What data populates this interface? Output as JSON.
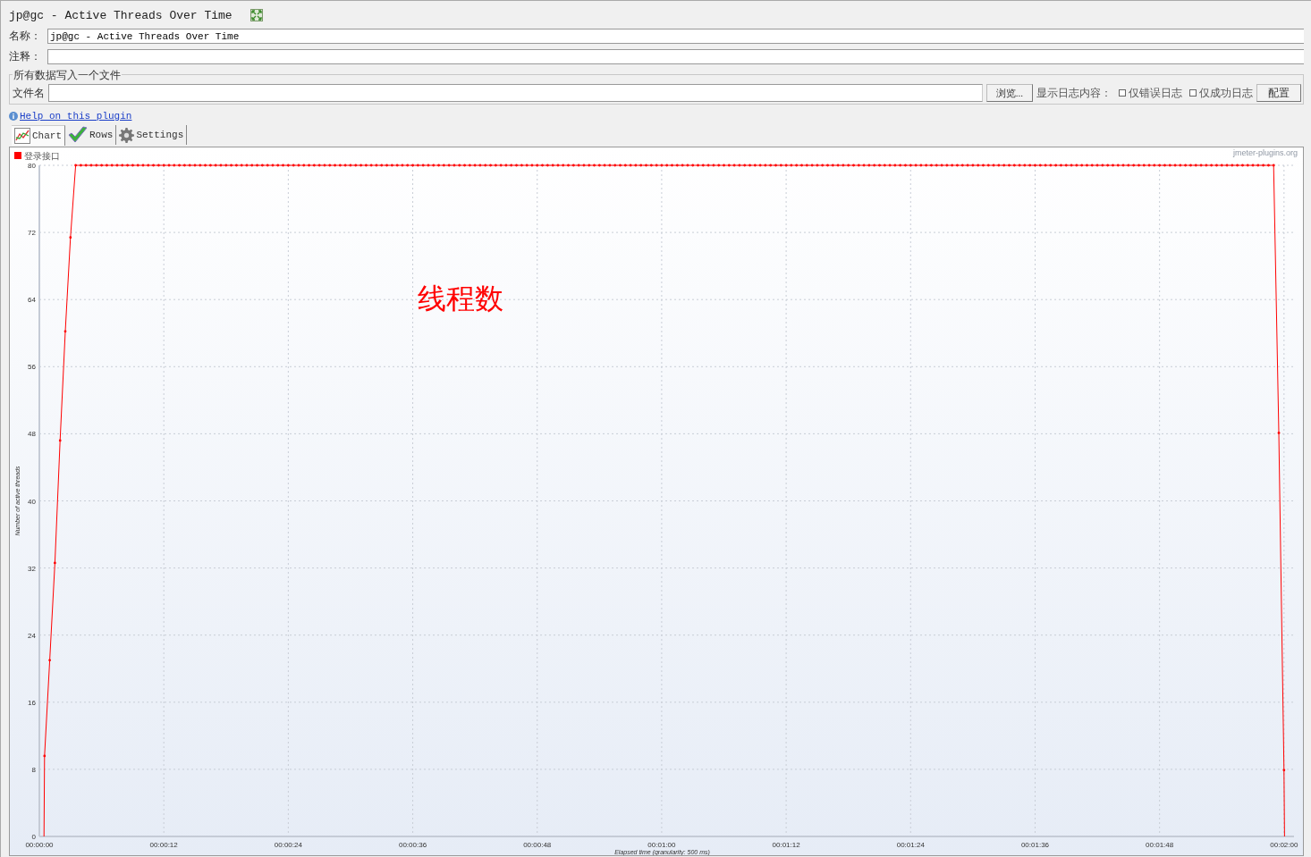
{
  "header": {
    "title": "jp@gc - Active Threads Over Time"
  },
  "name_field": {
    "label": "名称：",
    "value": "jp@gc - Active Threads Over Time"
  },
  "comment_field": {
    "label": "注释："
  },
  "file_group": {
    "title": "所有数据写入一个文件",
    "file_label": "文件名",
    "browse_button": "浏览...",
    "log_label": "显示日志内容：",
    "config_button": "配置",
    "checkboxes": [
      {
        "label": "仅错误日志",
        "checked": false
      },
      {
        "label": "仅成功日志",
        "checked": false
      }
    ]
  },
  "help_link": "Help on this plugin",
  "tabs": [
    {
      "label": "Chart",
      "kind": "chart",
      "selected": true
    },
    {
      "label": "Rows",
      "kind": "rows",
      "selected": false
    },
    {
      "label": "Settings",
      "kind": "settings",
      "selected": false
    }
  ],
  "chart": {
    "credit": "jmeter-plugins.org",
    "chart_data": {
      "type": "line",
      "xlabel": "Elapsed time (granularity: 500 ms)",
      "ylabel": "Number of active threads",
      "xlim": [
        0,
        120.1
      ],
      "ylim": [
        0,
        80
      ],
      "yticks": [
        0,
        8,
        16,
        24,
        32,
        40,
        48,
        56,
        64,
        72,
        80
      ],
      "xticks": [
        {
          "value": 0,
          "label": "00:00:00"
        },
        {
          "value": 12,
          "label": "00:00:12"
        },
        {
          "value": 24,
          "label": "00:00:24"
        },
        {
          "value": 36,
          "label": "00:00:36"
        },
        {
          "value": 48,
          "label": "00:00:48"
        },
        {
          "value": 60,
          "label": "00:01:00"
        },
        {
          "value": 72,
          "label": "00:01:12"
        },
        {
          "value": 84,
          "label": "00:01:24"
        },
        {
          "value": 96,
          "label": "00:01:36"
        },
        {
          "value": 108,
          "label": "00:01:48"
        },
        {
          "value": 120,
          "label": "00:02:00"
        }
      ],
      "annotations": [
        "线程数"
      ],
      "grid": true,
      "x": [
        0.45,
        0.5,
        1,
        1.5,
        2,
        2.5,
        3,
        3.5,
        4,
        4.5,
        5,
        5.5,
        6,
        6.5,
        7,
        7.5,
        8,
        8.5,
        9,
        9.5,
        10,
        10.5,
        11,
        11.5,
        12,
        12.5,
        13,
        13.5,
        14,
        14.5,
        15,
        15.5,
        16,
        16.5,
        17,
        17.5,
        18,
        18.5,
        19,
        19.5,
        20,
        20.5,
        21,
        21.5,
        22,
        22.5,
        23,
        23.5,
        24,
        24.5,
        25,
        25.5,
        26,
        26.5,
        27,
        27.5,
        28,
        28.5,
        29,
        29.5,
        30,
        30.5,
        31,
        31.5,
        32,
        32.5,
        33,
        33.5,
        34,
        34.5,
        35,
        35.5,
        36,
        36.5,
        37,
        37.5,
        38,
        38.5,
        39,
        39.5,
        40,
        40.5,
        41,
        41.5,
        42,
        42.5,
        43,
        43.5,
        44,
        44.5,
        45,
        45.5,
        46,
        46.5,
        47,
        47.5,
        48,
        48.5,
        49,
        49.5,
        50,
        50.5,
        51,
        51.5,
        52,
        52.5,
        53,
        53.5,
        54,
        54.5,
        55,
        55.5,
        56,
        56.5,
        57,
        57.5,
        58,
        58.5,
        59,
        59.5,
        60,
        60.5,
        61,
        61.5,
        62,
        62.5,
        63,
        63.5,
        64,
        64.5,
        65,
        65.5,
        66,
        66.5,
        67,
        67.5,
        68,
        68.5,
        69,
        69.5,
        70,
        70.5,
        71,
        71.5,
        72,
        72.5,
        73,
        73.5,
        74,
        74.5,
        75,
        75.5,
        76,
        76.5,
        77,
        77.5,
        78,
        78.5,
        79,
        79.5,
        80,
        80.5,
        81,
        81.5,
        82,
        82.5,
        83,
        83.5,
        84,
        84.5,
        85,
        85.5,
        86,
        86.5,
        87,
        87.5,
        88,
        88.5,
        89,
        89.5,
        90,
        90.5,
        91,
        91.5,
        92,
        92.5,
        93,
        93.5,
        94,
        94.5,
        95,
        95.5,
        96,
        96.5,
        97,
        97.5,
        98,
        98.5,
        99,
        99.5,
        100,
        100.5,
        101,
        101.5,
        102,
        102.5,
        103,
        103.5,
        104,
        104.5,
        105,
        105.5,
        106,
        106.5,
        107,
        107.5,
        108,
        108.5,
        109,
        109.5,
        110,
        110.5,
        111,
        111.5,
        112,
        112.5,
        113,
        113.5,
        114,
        114.5,
        115,
        115.5,
        116,
        116.5,
        117,
        117.5,
        118,
        118.5,
        119,
        119.5,
        120,
        120.05
      ],
      "series": [
        {
          "name": "登录接口",
          "color": "#ff0000",
          "values": [
            0,
            9.6,
            21,
            32.6,
            47.2,
            60.2,
            71.4,
            80,
            80,
            80,
            80,
            80,
            80,
            80,
            80,
            80,
            80,
            80,
            80,
            80,
            80,
            80,
            80,
            80,
            80,
            80,
            80,
            80,
            80,
            80,
            80,
            80,
            80,
            80,
            80,
            80,
            80,
            80,
            80,
            80,
            80,
            80,
            80,
            80,
            80,
            80,
            80,
            80,
            80,
            80,
            80,
            80,
            80,
            80,
            80,
            80,
            80,
            80,
            80,
            80,
            80,
            80,
            80,
            80,
            80,
            80,
            80,
            80,
            80,
            80,
            80,
            80,
            80,
            80,
            80,
            80,
            80,
            80,
            80,
            80,
            80,
            80,
            80,
            80,
            80,
            80,
            80,
            80,
            80,
            80,
            80,
            80,
            80,
            80,
            80,
            80,
            80,
            80,
            80,
            80,
            80,
            80,
            80,
            80,
            80,
            80,
            80,
            80,
            80,
            80,
            80,
            80,
            80,
            80,
            80,
            80,
            80,
            80,
            80,
            80,
            80,
            80,
            80,
            80,
            80,
            80,
            80,
            80,
            80,
            80,
            80,
            80,
            80,
            80,
            80,
            80,
            80,
            80,
            80,
            80,
            80,
            80,
            80,
            80,
            80,
            80,
            80,
            80,
            80,
            80,
            80,
            80,
            80,
            80,
            80,
            80,
            80,
            80,
            80,
            80,
            80,
            80,
            80,
            80,
            80,
            80,
            80,
            80,
            80,
            80,
            80,
            80,
            80,
            80,
            80,
            80,
            80,
            80,
            80,
            80,
            80,
            80,
            80,
            80,
            80,
            80,
            80,
            80,
            80,
            80,
            80,
            80,
            80,
            80,
            80,
            80,
            80,
            80,
            80,
            80,
            80,
            80,
            80,
            80,
            80,
            80,
            80,
            80,
            80,
            80,
            80,
            80,
            80,
            80,
            80,
            80,
            80,
            80,
            80,
            80,
            80,
            80,
            80,
            80,
            80,
            80,
            80,
            80,
            80,
            80,
            80,
            80,
            80,
            80,
            80,
            80,
            80,
            80,
            80,
            48.1,
            7.9,
            0
          ]
        }
      ]
    }
  }
}
